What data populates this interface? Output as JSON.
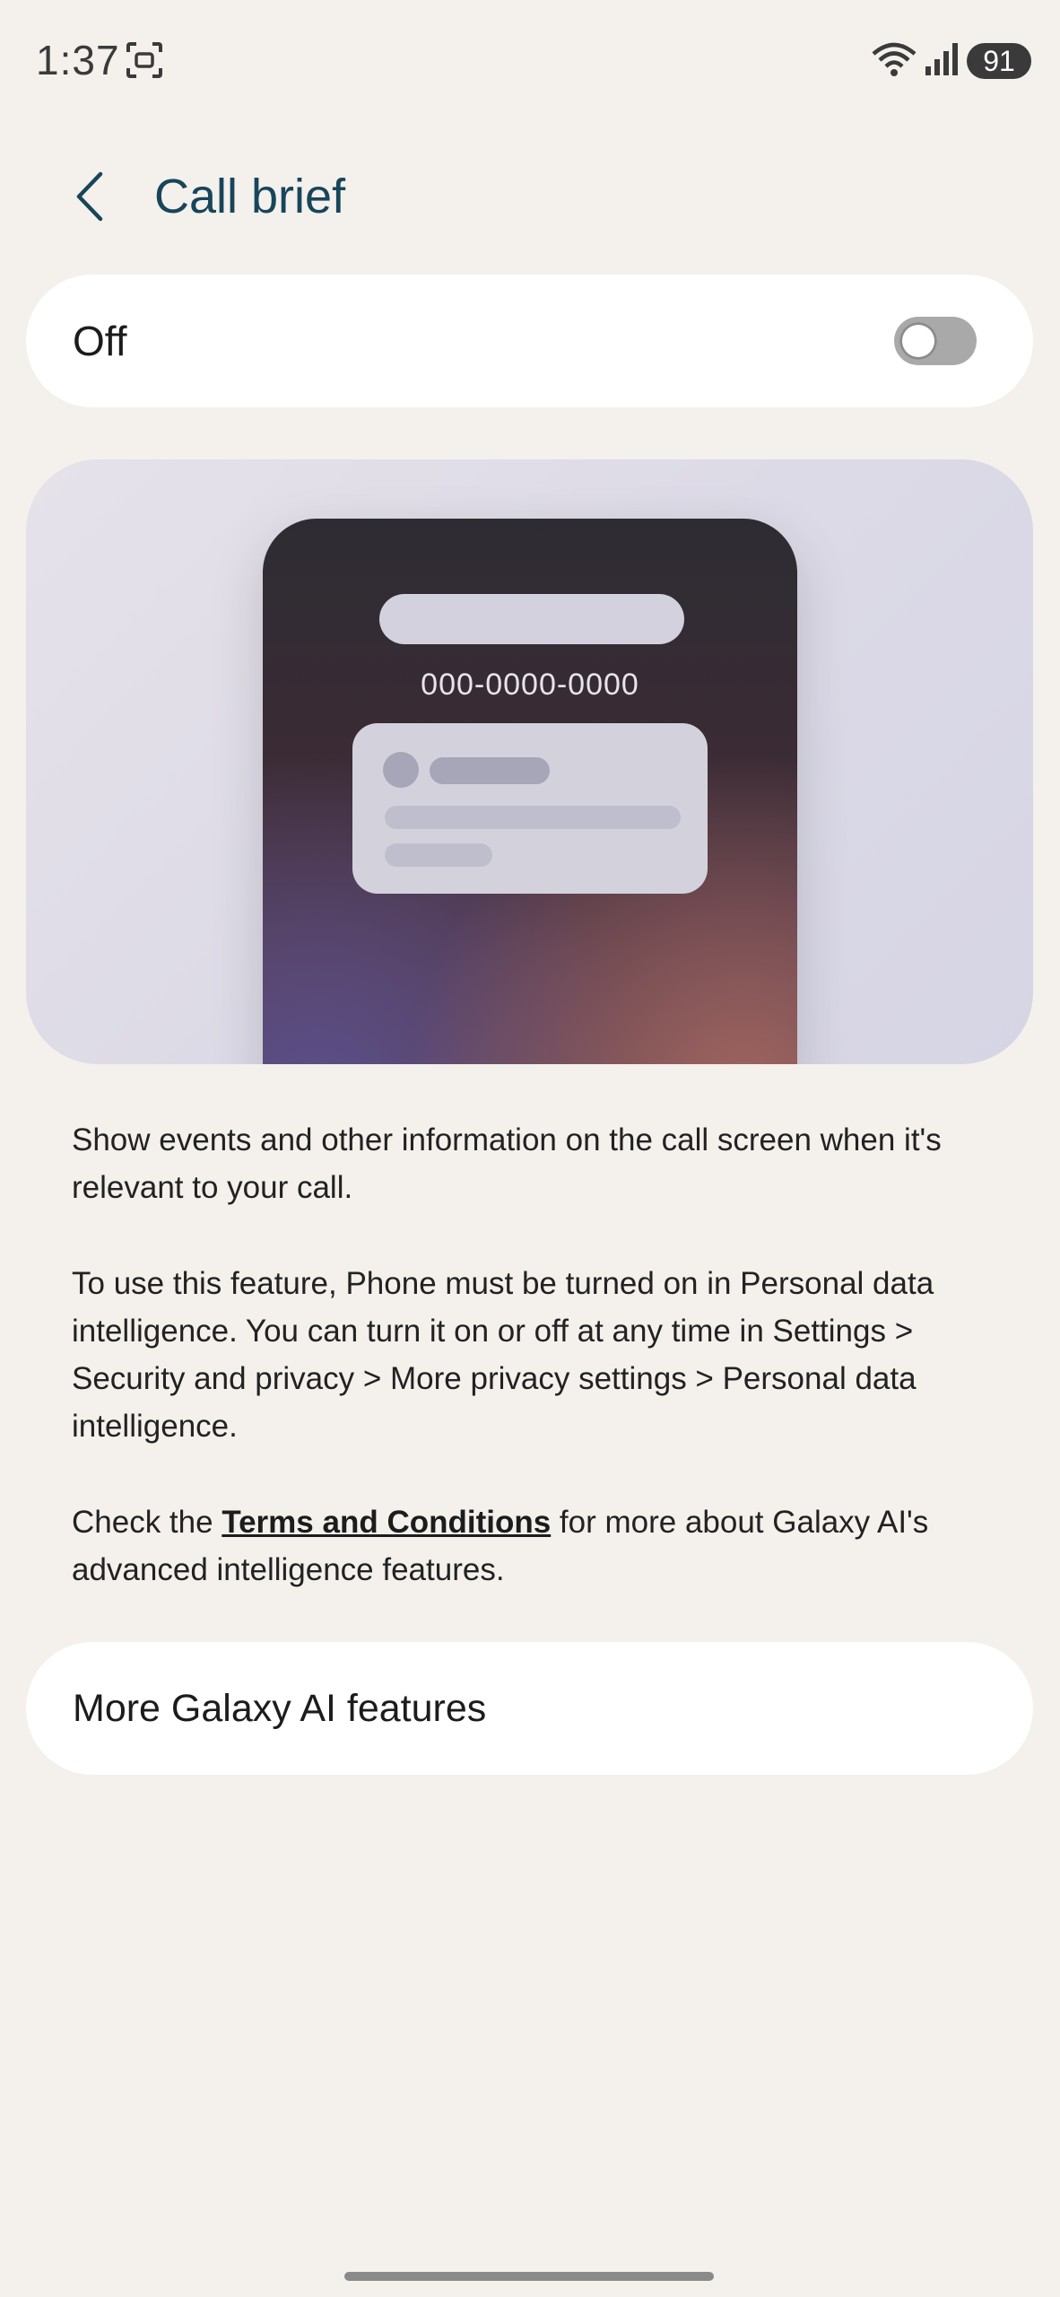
{
  "status_bar": {
    "time": "1:37",
    "battery": "91"
  },
  "header": {
    "title": "Call brief"
  },
  "toggle": {
    "label": "Off",
    "state": "off"
  },
  "illustration": {
    "phone_number": "000-0000-0000"
  },
  "description": {
    "paragraph1": "Show events and other information on the call screen when it's relevant to your call.",
    "paragraph2": "To use this feature, Phone must be turned on in Personal data intelligence. You can turn it on or off at any time in Settings > Security and privacy > More privacy settings > Personal data intelligence.",
    "paragraph3_prefix": "Check the ",
    "terms_link": "Terms and Conditions",
    "paragraph3_suffix": " for more about Galaxy AI's advanced intelligence features."
  },
  "more_features": {
    "label": "More Galaxy AI features"
  },
  "colors": {
    "background": "#f4f0ec",
    "title": "#17455a",
    "switch_off": "#a9a9a9"
  }
}
